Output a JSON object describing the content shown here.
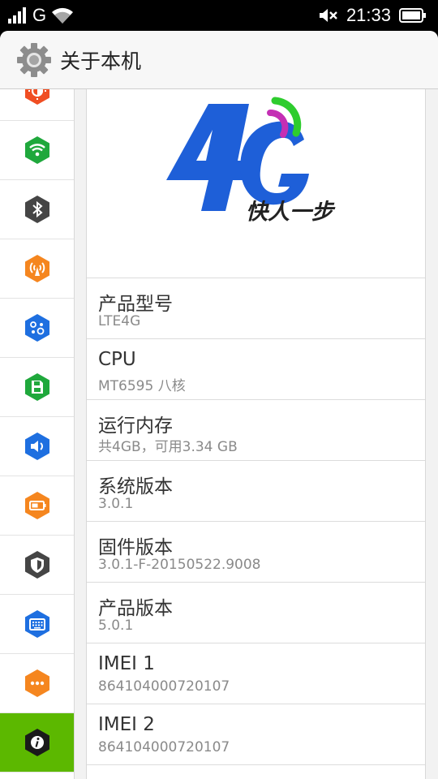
{
  "status_bar": {
    "network_type": "G",
    "time": "21:33",
    "icons": [
      "signal-icon",
      "wifi-icon",
      "mute-icon",
      "battery-icon"
    ]
  },
  "header": {
    "title": "关于本机",
    "icon": "gear-icon"
  },
  "sidebar": {
    "items": [
      {
        "icon": "brightness-icon",
        "color": "#f04e23"
      },
      {
        "icon": "wifi-icon",
        "color": "#1fa83c"
      },
      {
        "icon": "bluetooth-icon",
        "color": "#454545"
      },
      {
        "icon": "hotspot-icon",
        "color": "#f5861f"
      },
      {
        "icon": "apps-icon",
        "color": "#1e6fe0"
      },
      {
        "icon": "storage-icon",
        "color": "#1fa83c"
      },
      {
        "icon": "sound-icon",
        "color": "#1e6fe0"
      },
      {
        "icon": "battery-icon",
        "color": "#f5861f"
      },
      {
        "icon": "security-icon",
        "color": "#454545"
      },
      {
        "icon": "keyboard-icon",
        "color": "#1e6fe0"
      },
      {
        "icon": "more-icon",
        "color": "#f5861f"
      },
      {
        "icon": "about-icon",
        "color": "#1a1a1a",
        "active": true
      }
    ],
    "active_color": "#5cb800"
  },
  "banner": {
    "logo_text": "4G",
    "slogan": "快人一步",
    "logo_color": "#1e5fd8",
    "wave_colors": [
      "#2ecc2e",
      "#c42fb4"
    ]
  },
  "info": [
    {
      "label": "产品型号",
      "value": "LTE4G"
    },
    {
      "label": "CPU",
      "value": "MT6595 八核"
    },
    {
      "label": "运行内存",
      "value": "共4GB，可用3.34 GB"
    },
    {
      "label": "系统版本",
      "value": "3.0.1"
    },
    {
      "label": "固件版本",
      "value": "3.0.1-F-20150522.9008"
    },
    {
      "label": "产品版本",
      "value": "5.0.1"
    },
    {
      "label": "IMEI 1",
      "value": "864104000720107"
    },
    {
      "label": "IMEI 2",
      "value": "864104000720107"
    }
  ]
}
